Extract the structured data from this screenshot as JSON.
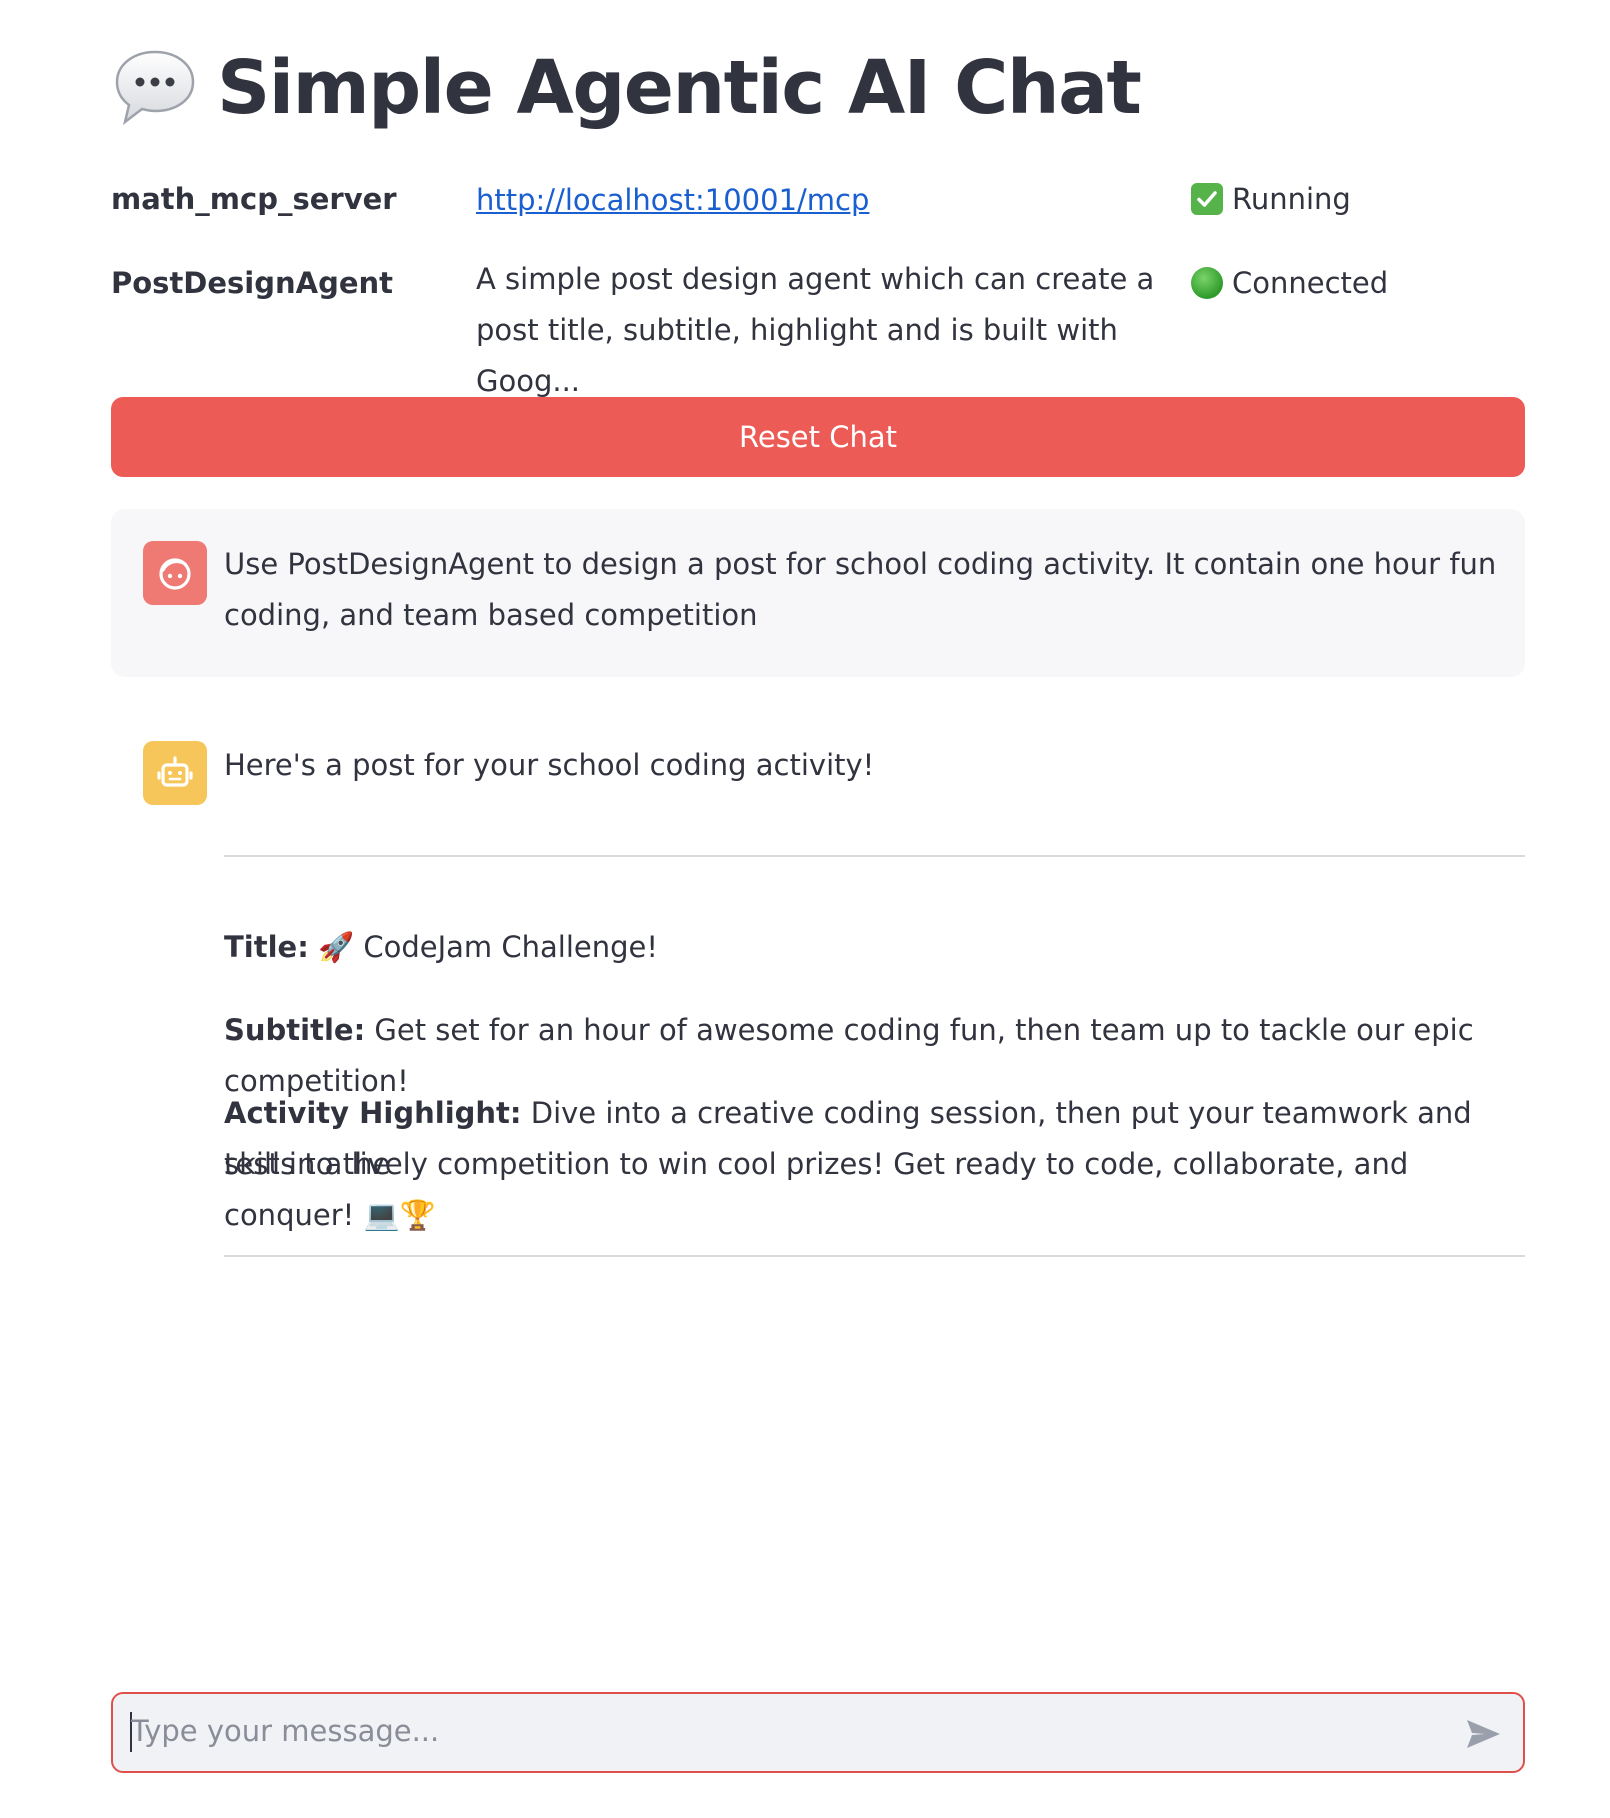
{
  "header": {
    "title": "Simple Agentic AI Chat",
    "title_icon": "speech-bubble-icon"
  },
  "servers": [
    {
      "name": "math_mcp_server",
      "detail": "http://localhost:10001/mcp",
      "status_icon": "check-mark-icon",
      "status": "Running"
    },
    {
      "name": "PostDesignAgent",
      "detail": "A simple post design agent which can create a post title, subtitle, highlight and is built with Goog...",
      "status_icon": "green-circle-icon",
      "status": "Connected"
    }
  ],
  "reset_button": {
    "label": "Reset Chat"
  },
  "messages": {
    "user": {
      "avatar_icon": "user-face-icon",
      "text": "Use PostDesignAgent to design a post for school coding activity. It contain one hour fun coding, and team based competition"
    },
    "assistant": {
      "avatar_icon": "robot-icon",
      "intro": "Here's a post for your school coding activity!",
      "title_label": "Title:",
      "title_value": "🚀 CodeJam Challenge!",
      "subtitle_label": "Subtitle:",
      "subtitle_value": "Get set for an hour of awesome coding fun, then team up to tackle our epic competition!",
      "highlight_label": "Activity Highlight:",
      "highlight_value_line1": "Dive into a creative coding session, then put your teamwork and skills to the",
      "highlight_value_line2": "test in a lively competition to win cool prizes! Get ready to code, collaborate, and conquer! 💻🏆"
    }
  },
  "chat_input": {
    "placeholder": "Type your message...",
    "value": ""
  },
  "colors": {
    "accent": "#ec5b55",
    "link": "#1a5fd0",
    "user_avatar": "#ee7a73",
    "bot_avatar": "#f7c65a",
    "text": "#31333f"
  }
}
